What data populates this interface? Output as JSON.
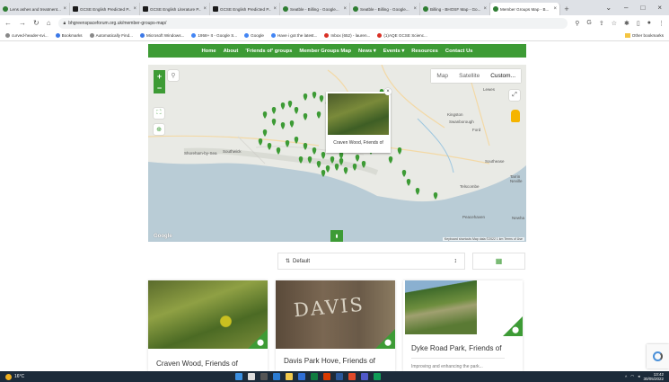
{
  "browser": {
    "tabs": [
      {
        "label": "Lens ashes and treatment...",
        "active": false
      },
      {
        "label": "GCSE English Predicted P...",
        "active": false
      },
      {
        "label": "GCSE English Literature P...",
        "active": false
      },
      {
        "label": "GCSE English Predicted P...",
        "active": false
      },
      {
        "label": "Seatble - Billing - Google...",
        "active": false
      },
      {
        "label": "Seatble - Billing - Google...",
        "active": false
      },
      {
        "label": "Billing - BHOSF Map - Go...",
        "active": false
      },
      {
        "label": "Member Groups Map - B...",
        "active": true
      }
    ],
    "url": "bhgreenspaceforum.org.uk/member-groups-map/",
    "bookmarks": [
      "curved-header-svi...",
      "Bookmarks",
      "Automatically Find...",
      "Microsoft Windows...",
      "1958+ It - Google S...",
      "Google",
      "Have i got the latest...",
      "Inbox (652) - lauren...",
      "(1)AQE GCSE Scienc..."
    ],
    "other_bookmarks": "Other bookmarks"
  },
  "nav": {
    "items": [
      "Home",
      "About",
      "'Friends of' groups",
      "Member Groups Map",
      "News ▾",
      "Events ▾",
      "Resources",
      "Contact Us"
    ]
  },
  "map": {
    "zoom_in": "+",
    "zoom_out": "−",
    "type_options": [
      "Map",
      "Satellite",
      "Custom..."
    ],
    "selected_type": "Custom...",
    "popup_caption": "Craven Wood, Friends of",
    "place_labels": [
      "Kingston",
      "Swanborough",
      "Lewes",
      "Ford",
      "Southease",
      "Shoreham-by-Sea",
      "Southwick",
      "Telscombe",
      "Peacehaven",
      "Tarrin Neville",
      "Newha"
    ],
    "google_label": "Google",
    "attribution": "Keyboard shortcuts  Map data ©2022  1 km  Terms of Use"
  },
  "filter": {
    "label": "Default",
    "caret": "↕"
  },
  "cards": [
    {
      "title": "Craven Wood, Friends of",
      "desc": ""
    },
    {
      "title": "Davis Park Hove, Friends of",
      "desc": "",
      "sign": "DAVIS"
    },
    {
      "title": "Dyke Road Park, Friends of",
      "desc": "Improving and enhancing the park..."
    }
  ],
  "taskbar": {
    "weather": "16°C",
    "time": "13:42",
    "date": "30/05/2022"
  },
  "colors": {
    "brand_green": "#3d9b35",
    "sea": "#b9ccd6",
    "land": "#e8e8e4"
  }
}
